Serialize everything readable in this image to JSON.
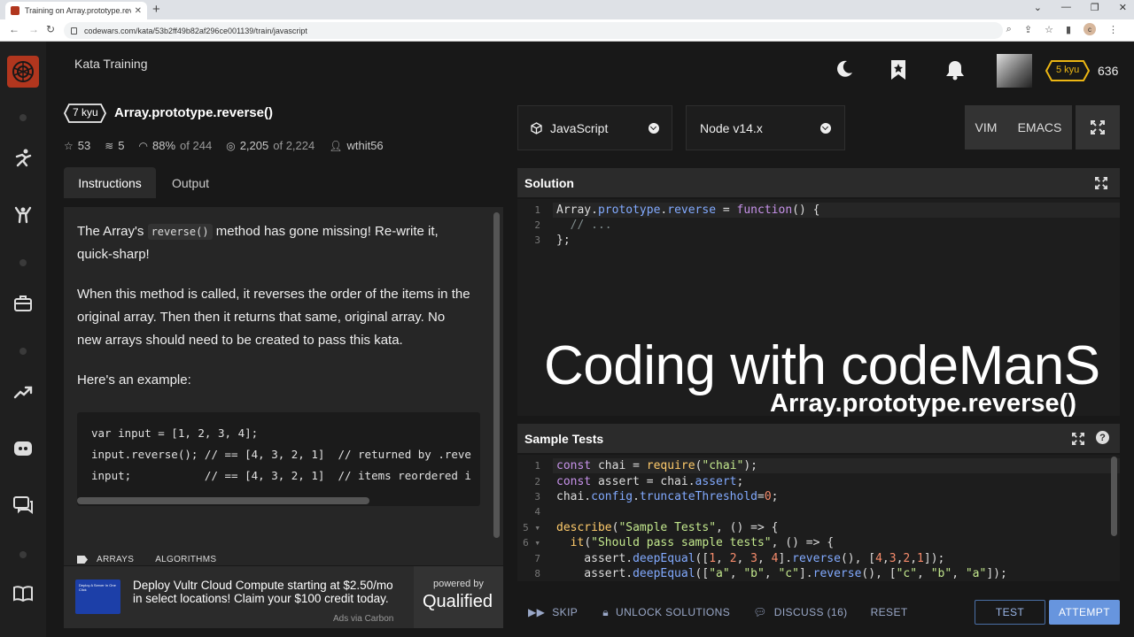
{
  "browser": {
    "tab_title": "Training on Array.prototype.reve",
    "url": "codewars.com/kata/53b2ff49b82af296ce001139/train/javascript"
  },
  "header": {
    "title": "Kata Training",
    "rank": "5 kyu",
    "honor": "636"
  },
  "kata": {
    "kyu": "7 kyu",
    "title": "Array.prototype.reverse()",
    "stars": "53",
    "collections": "5",
    "satisfaction_pct": "88%",
    "satisfaction_of": "of 244",
    "completed": "2,205",
    "completed_of": "of 2,224",
    "author": "wthit56"
  },
  "tabs": {
    "instructions": "Instructions",
    "output": "Output"
  },
  "description": {
    "p1_a": "The Array's",
    "p1_code": "reverse()",
    "p1_b": "method has gone missing! Re-write it, quick-sharp!",
    "p2": "When this method is called, it reverses the order of the items in the original array. Then then it returns that same, original array. No new arrays should need to be created to pass this kata.",
    "p3": "Here's an example:",
    "code": [
      "var input = [1, 2, 3, 4];",
      "input.reverse(); // == [4, 3, 2, 1]  // returned by .reve",
      "input;           // == [4, 3, 2, 1]  // items reordered i"
    ],
    "tags": [
      "ARRAYS",
      "ALGORITHMS"
    ]
  },
  "ad": {
    "thumb_text": "Deploy A Server In One Click",
    "text": "Deploy Vultr Cloud Compute starting at $2.50/mo in select locations! Claim your $100 credit today.",
    "via": "Ads via Carbon",
    "powered_by": "powered by",
    "brand": "Qualified"
  },
  "editor": {
    "language": "JavaScript",
    "version": "Node v14.x",
    "vim": "VIM",
    "emacs": "EMACS",
    "solution_title": "Solution",
    "tests_title": "Sample Tests"
  },
  "watermark": {
    "line1": "Coding with codeManS",
    "line2": "Array.prototype.reverse()"
  },
  "actions": {
    "skip": "SKIP",
    "unlock": "UNLOCK SOLUTIONS",
    "discuss": "DISCUSS (16)",
    "reset": "RESET",
    "test": "TEST",
    "attempt": "ATTEMPT"
  },
  "colors": {
    "accent": "#6795de",
    "brand": "#b1361e",
    "rank_yellow": "#ecb613"
  }
}
